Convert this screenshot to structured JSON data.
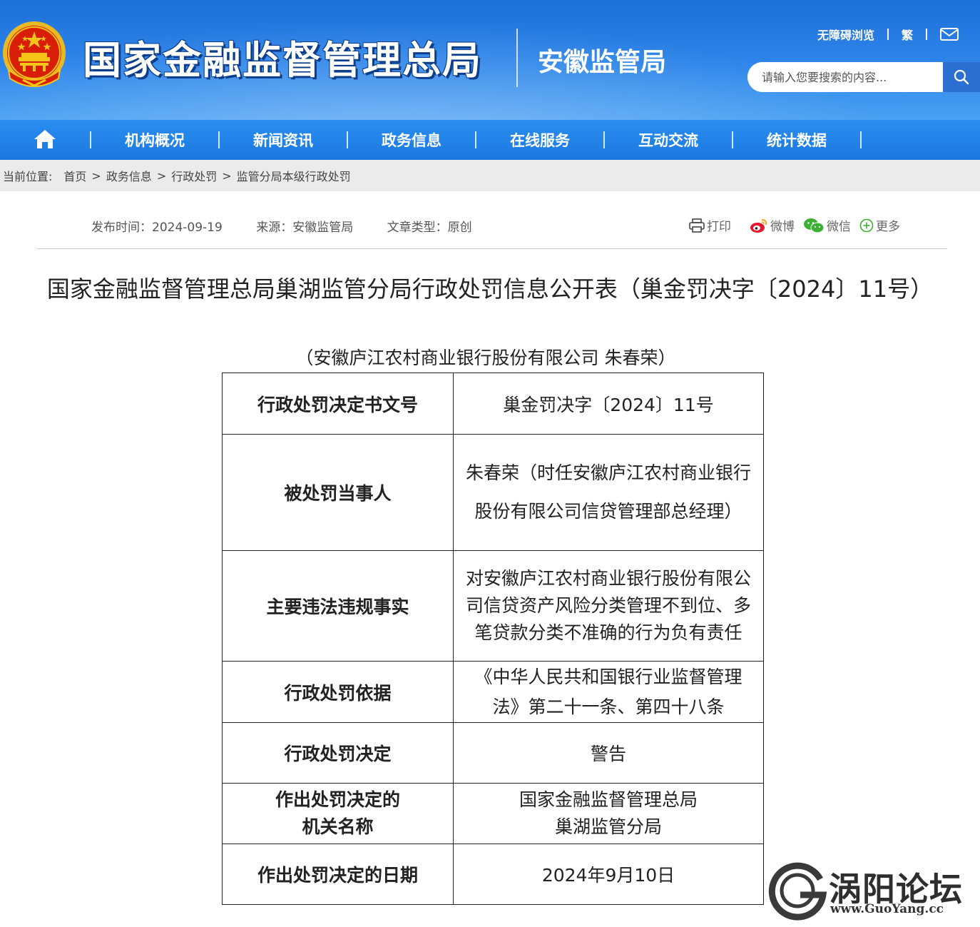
{
  "header": {
    "agency_name": "国家金融监督管理总局",
    "bureau_name": "安徽监管局",
    "links": {
      "accessibility": "无障碍浏览",
      "traditional": "繁"
    },
    "search": {
      "placeholder": "请输入您要搜索的内容..."
    }
  },
  "nav": {
    "items": [
      {
        "label": "机构概况"
      },
      {
        "label": "新闻资讯"
      },
      {
        "label": "政务信息"
      },
      {
        "label": "在线服务"
      },
      {
        "label": "互动交流"
      },
      {
        "label": "统计数据"
      }
    ]
  },
  "breadcrumb": {
    "label": "当前位置:",
    "items": [
      "首页",
      "政务信息",
      "行政处罚",
      "监管分局本级行政处罚"
    ],
    "separator": ">"
  },
  "meta": {
    "publish": "发布时间：2024-09-19",
    "source": "来源：安徽监管局",
    "type": "文章类型：原创"
  },
  "share": {
    "print": "打印",
    "weibo": "微博",
    "wechat": "微信",
    "more": "更多"
  },
  "article": {
    "title": "国家金融监督管理总局巢湖监管分局行政处罚信息公开表（巢金罚决字〔2024〕11号）",
    "subtitle": "（安徽庐江农村商业银行股份有限公司 朱春荣）",
    "table": {
      "r1_key": "行政处罚决定书文号",
      "r1_val": "巢金罚决字〔2024〕11号",
      "r2_key": "被处罚当事人",
      "r2_val": "朱春荣（时任安徽庐江农村商业银行股份有限公司信贷管理部总经理）",
      "r3_key": "主要违法违规事实",
      "r3_val": "对安徽庐江农村商业银行股份有限公司信贷资产风险分类管理不到位、多笔贷款分类不准确的行为负有责任",
      "r4_key": "行政处罚依据",
      "r4_val": "《中华人民共和国银行业监督管理法》第二十一条、第四十八条",
      "r5_key": "行政处罚决定",
      "r5_val": "警告",
      "r6_key_line1": "作出处罚决定的",
      "r6_key_line2": "机关名称",
      "r6_val_line1": "国家金融监督管理总局",
      "r6_val_line2": "巢湖监管分局",
      "r7_key": "作出处罚决定的日期",
      "r7_val": "2024年9月10日"
    }
  },
  "watermark": {
    "name": "涡阳论坛",
    "url": "www.GuoYang.cc"
  },
  "colors": {
    "header_blue": "#2f86ea",
    "nav_blue": "#1a78e0",
    "emblem_red": "#d81e06",
    "emblem_gold": "#f5c518"
  }
}
